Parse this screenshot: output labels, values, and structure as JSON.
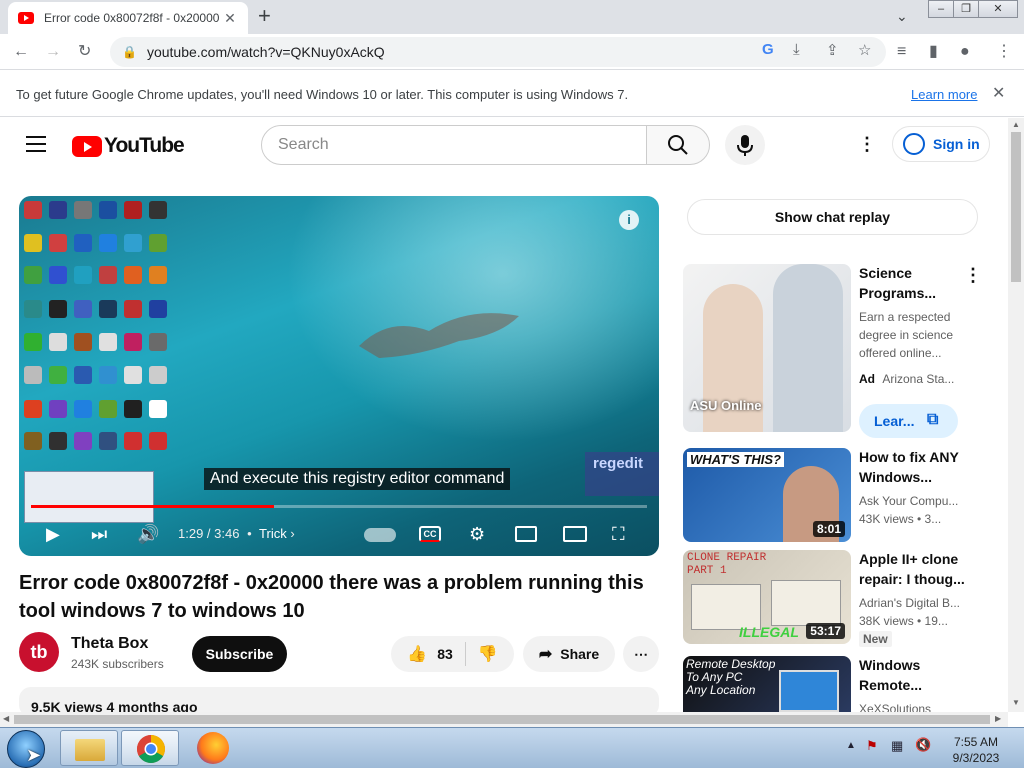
{
  "browser": {
    "tab_title": "Error code 0x80072f8f - 0x20000",
    "new_tab_symbol": "+",
    "url": "youtube.com/watch?v=QKNuy0xAckQ",
    "infobar_message": "To get future Google Chrome updates, you'll need Windows 10 or later. This computer is using Windows 7.",
    "infobar_link": "Learn more"
  },
  "youtube": {
    "logo_text": "YouTube",
    "search_placeholder": "Search",
    "sign_in": "Sign in"
  },
  "video": {
    "subtitle": "And execute this registry editor command",
    "overlay_badge": "regedit",
    "time": "1:29 / 3:46",
    "chapter": "Trick",
    "progress_fraction": 0.394,
    "title": "Error code 0x80072f8f - 0x20000 there was a problem running this tool windows 7 to windows 10",
    "channel_name": "Theta Box",
    "channel_initials": "tb",
    "subscribers": "243K subscribers",
    "subscribe_label": "Subscribe",
    "likes": "83",
    "share_label": "Share",
    "description_stats": "9.5K views  4 months ago"
  },
  "sidebar": {
    "chat_replay": "Show chat replay",
    "ad": {
      "title_line1": "Science",
      "title_line2": "Programs...",
      "desc1": "Earn a respected",
      "desc2": "degree in science",
      "desc3": "offered online...",
      "ad_label": "Ad",
      "advertiser": "Arizona Sta...",
      "cta": "Lear...",
      "thumb_text": "ASU Online"
    },
    "videos": [
      {
        "title1": "How to fix ANY",
        "title2": "Windows...",
        "channel": "Ask Your Compu...",
        "meta": "43K views • 3...",
        "duration": "8:01",
        "thumb_text": "WHAT'S THIS?"
      },
      {
        "title1": "Apple II+ clone",
        "title2": "repair: I thoug...",
        "channel": "Adrian's Digital B...",
        "meta": "38K views • 19...",
        "badge": "New",
        "duration": "53:17",
        "thumb_text1": "CLONE REPAIR",
        "thumb_text2": "PART 1",
        "thumb_text3": "ILLEGAL"
      },
      {
        "title1": "Windows",
        "title2": "Remote...",
        "channel": "XeXSolutions",
        "thumb_text1": "Remote Desktop",
        "thumb_text2": "To Any PC",
        "thumb_text3": "Any Location"
      }
    ]
  },
  "taskbar": {
    "time": "7:55 AM",
    "date": "9/3/2023"
  },
  "colors": {
    "youtube_red": "#ff0000",
    "link_blue": "#065fd4",
    "chrome_tabstrip": "#dee1e6"
  }
}
